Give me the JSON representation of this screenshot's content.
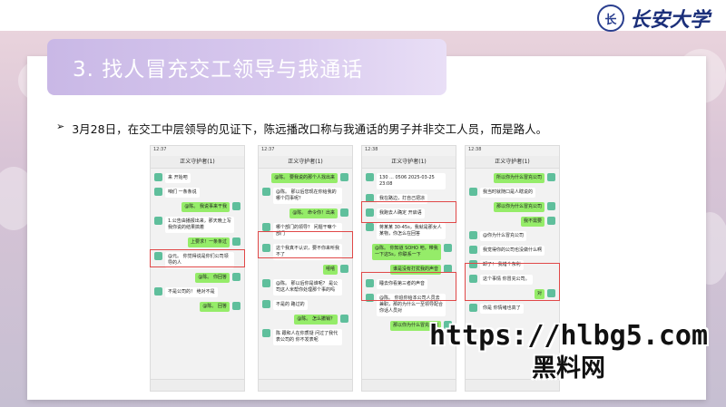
{
  "brand": {
    "seal_glyph": "长",
    "name": "长安大学"
  },
  "slide": {
    "title": "3. 找人冒充交工领导与我通话",
    "bullet": "3月28日，在交工中层领导的见证下，陈远播改口称与我通话的男子并非交工人员，而是路人。"
  },
  "screenshots": [
    {
      "time": "12:37",
      "chat_title": "正义守护者(1)",
      "messages": [
        {
          "side": "left",
          "text": "来 开始吧"
        },
        {
          "side": "left",
          "text": "咱们 一条条说"
        },
        {
          "side": "right",
          "text": "@陈。 我说事来干我"
        },
        {
          "side": "left",
          "text": "1.公告由播报出来，那天晚上写我你说的结果搞着"
        },
        {
          "side": "right",
          "text": "上要求！一条条过"
        },
        {
          "side": "left",
          "text": "@元。 你觉得说是你们公司领导的人"
        },
        {
          "side": "right",
          "text": "@陈。 你回答"
        },
        {
          "side": "left",
          "text": "不是公司的！ 绝对不是"
        },
        {
          "side": "right",
          "text": "@陈。 回答"
        }
      ]
    },
    {
      "time": "12:37",
      "chat_title": "正义守护者(1)",
      "messages": [
        {
          "side": "right",
          "text": "@陈。 要我说的那个人找出来"
        },
        {
          "side": "left",
          "text": "@陈。 那以后您现在你给我的哪个同事呢？"
        },
        {
          "side": "right",
          "text": "@陈。 命令你！出来"
        },
        {
          "side": "left",
          "text": "哪个部门的领导？ 问题干嘛个部门"
        },
        {
          "side": "left",
          "text": "这个我真不认识，要不你来听我不了"
        },
        {
          "side": "right",
          "text": "嘻嘻"
        },
        {
          "side": "left",
          "text": "@陈。 那以后你是谁呢？ 是公司这人米帮你处理那个事的吗"
        },
        {
          "side": "left",
          "text": "不是的 路过的"
        },
        {
          "side": "right",
          "text": "@陈。 怎么撤销？"
        },
        {
          "side": "left",
          "text": "陈 跟和人在你质疑 问过了我代表公司的 你不发表呢"
        }
      ]
    },
    {
      "time": "12:38",
      "chat_title": "正义守护者(1)",
      "messages": [
        {
          "side": "left",
          "text": "130 ... 0506  2025-03-25 23:08"
        },
        {
          "side": "left",
          "text": "我在路边，打自己把凉"
        },
        {
          "side": "left",
          "text": "我跑去人确定 开启语"
        },
        {
          "side": "left",
          "text": "蒋某某 30-45s，我就是那女人某物，你怎么在回答"
        },
        {
          "side": "right",
          "text": "@陈。 你知道 SOHO 吧，带我一下这5s，你联系一下"
        },
        {
          "side": "right",
          "text": "谁是没有打扰我的声音"
        },
        {
          "side": "left",
          "text": "睡去你看第三者的声音"
        },
        {
          "side": "left",
          "text": "@陈。 你追你给本公司人员去兼职，那的为什么一至领导配合你话人员对"
        },
        {
          "side": "right",
          "text": "那以你为什么冒充公司"
        }
      ]
    },
    {
      "time": "12:38",
      "chat_title": "正义守护者(1)",
      "messages": [
        {
          "side": "right",
          "text": "所以你为什么冒充公司"
        },
        {
          "side": "left",
          "text": "我当时就随口是人瞎说的"
        },
        {
          "side": "right",
          "text": "那以你为什么冒充公司"
        },
        {
          "side": "right",
          "text": "我不需要"
        },
        {
          "side": "left",
          "text": "@你为什么冒充公司"
        },
        {
          "side": "left",
          "text": "我觉得你的公司也没做什么啊"
        },
        {
          "side": "left",
          "text": "卸了！ 我错个东利"
        },
        {
          "side": "left",
          "text": "这个事情 你冒充公司。"
        },
        {
          "side": "right",
          "text": "对"
        },
        {
          "side": "left",
          "text": "你是 你情绪也高了"
        }
      ]
    }
  ],
  "watermark": {
    "line1": "https://hlbg5.com",
    "line2": "黑料网"
  }
}
